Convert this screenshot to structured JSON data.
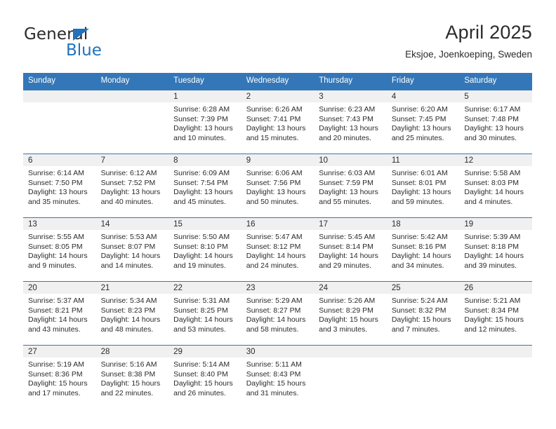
{
  "brand": {
    "name_top": "General",
    "name_bottom": "Blue",
    "triangle_color": "#1f72bd",
    "text_color": "#2b2b2b"
  },
  "header": {
    "title": "April 2025",
    "subtitle": "Eksjoe, Joenkoeping, Sweden"
  },
  "theme": {
    "header_blue": "#3477b8",
    "band_gray": "#f0f0f0",
    "text": "#2b2b2b",
    "cell_bg": "#ffffff"
  },
  "weekdays": [
    "Sunday",
    "Monday",
    "Tuesday",
    "Wednesday",
    "Thursday",
    "Friday",
    "Saturday"
  ],
  "labels": {
    "sunrise_prefix": "Sunrise:",
    "sunset_prefix": "Sunset:",
    "daylight_prefix": "Daylight:"
  },
  "weeks": [
    [
      {
        "empty": true
      },
      {
        "empty": true
      },
      {
        "day": "1",
        "sunrise": "Sunrise: 6:28 AM",
        "sunset": "Sunset: 7:39 PM",
        "daylight_1": "Daylight: 13 hours",
        "daylight_2": "and 10 minutes."
      },
      {
        "day": "2",
        "sunrise": "Sunrise: 6:26 AM",
        "sunset": "Sunset: 7:41 PM",
        "daylight_1": "Daylight: 13 hours",
        "daylight_2": "and 15 minutes."
      },
      {
        "day": "3",
        "sunrise": "Sunrise: 6:23 AM",
        "sunset": "Sunset: 7:43 PM",
        "daylight_1": "Daylight: 13 hours",
        "daylight_2": "and 20 minutes."
      },
      {
        "day": "4",
        "sunrise": "Sunrise: 6:20 AM",
        "sunset": "Sunset: 7:45 PM",
        "daylight_1": "Daylight: 13 hours",
        "daylight_2": "and 25 minutes."
      },
      {
        "day": "5",
        "sunrise": "Sunrise: 6:17 AM",
        "sunset": "Sunset: 7:48 PM",
        "daylight_1": "Daylight: 13 hours",
        "daylight_2": "and 30 minutes."
      }
    ],
    [
      {
        "day": "6",
        "sunrise": "Sunrise: 6:14 AM",
        "sunset": "Sunset: 7:50 PM",
        "daylight_1": "Daylight: 13 hours",
        "daylight_2": "and 35 minutes."
      },
      {
        "day": "7",
        "sunrise": "Sunrise: 6:12 AM",
        "sunset": "Sunset: 7:52 PM",
        "daylight_1": "Daylight: 13 hours",
        "daylight_2": "and 40 minutes."
      },
      {
        "day": "8",
        "sunrise": "Sunrise: 6:09 AM",
        "sunset": "Sunset: 7:54 PM",
        "daylight_1": "Daylight: 13 hours",
        "daylight_2": "and 45 minutes."
      },
      {
        "day": "9",
        "sunrise": "Sunrise: 6:06 AM",
        "sunset": "Sunset: 7:56 PM",
        "daylight_1": "Daylight: 13 hours",
        "daylight_2": "and 50 minutes."
      },
      {
        "day": "10",
        "sunrise": "Sunrise: 6:03 AM",
        "sunset": "Sunset: 7:59 PM",
        "daylight_1": "Daylight: 13 hours",
        "daylight_2": "and 55 minutes."
      },
      {
        "day": "11",
        "sunrise": "Sunrise: 6:01 AM",
        "sunset": "Sunset: 8:01 PM",
        "daylight_1": "Daylight: 13 hours",
        "daylight_2": "and 59 minutes."
      },
      {
        "day": "12",
        "sunrise": "Sunrise: 5:58 AM",
        "sunset": "Sunset: 8:03 PM",
        "daylight_1": "Daylight: 14 hours",
        "daylight_2": "and 4 minutes."
      }
    ],
    [
      {
        "day": "13",
        "sunrise": "Sunrise: 5:55 AM",
        "sunset": "Sunset: 8:05 PM",
        "daylight_1": "Daylight: 14 hours",
        "daylight_2": "and 9 minutes."
      },
      {
        "day": "14",
        "sunrise": "Sunrise: 5:53 AM",
        "sunset": "Sunset: 8:07 PM",
        "daylight_1": "Daylight: 14 hours",
        "daylight_2": "and 14 minutes."
      },
      {
        "day": "15",
        "sunrise": "Sunrise: 5:50 AM",
        "sunset": "Sunset: 8:10 PM",
        "daylight_1": "Daylight: 14 hours",
        "daylight_2": "and 19 minutes."
      },
      {
        "day": "16",
        "sunrise": "Sunrise: 5:47 AM",
        "sunset": "Sunset: 8:12 PM",
        "daylight_1": "Daylight: 14 hours",
        "daylight_2": "and 24 minutes."
      },
      {
        "day": "17",
        "sunrise": "Sunrise: 5:45 AM",
        "sunset": "Sunset: 8:14 PM",
        "daylight_1": "Daylight: 14 hours",
        "daylight_2": "and 29 minutes."
      },
      {
        "day": "18",
        "sunrise": "Sunrise: 5:42 AM",
        "sunset": "Sunset: 8:16 PM",
        "daylight_1": "Daylight: 14 hours",
        "daylight_2": "and 34 minutes."
      },
      {
        "day": "19",
        "sunrise": "Sunrise: 5:39 AM",
        "sunset": "Sunset: 8:18 PM",
        "daylight_1": "Daylight: 14 hours",
        "daylight_2": "and 39 minutes."
      }
    ],
    [
      {
        "day": "20",
        "sunrise": "Sunrise: 5:37 AM",
        "sunset": "Sunset: 8:21 PM",
        "daylight_1": "Daylight: 14 hours",
        "daylight_2": "and 43 minutes."
      },
      {
        "day": "21",
        "sunrise": "Sunrise: 5:34 AM",
        "sunset": "Sunset: 8:23 PM",
        "daylight_1": "Daylight: 14 hours",
        "daylight_2": "and 48 minutes."
      },
      {
        "day": "22",
        "sunrise": "Sunrise: 5:31 AM",
        "sunset": "Sunset: 8:25 PM",
        "daylight_1": "Daylight: 14 hours",
        "daylight_2": "and 53 minutes."
      },
      {
        "day": "23",
        "sunrise": "Sunrise: 5:29 AM",
        "sunset": "Sunset: 8:27 PM",
        "daylight_1": "Daylight: 14 hours",
        "daylight_2": "and 58 minutes."
      },
      {
        "day": "24",
        "sunrise": "Sunrise: 5:26 AM",
        "sunset": "Sunset: 8:29 PM",
        "daylight_1": "Daylight: 15 hours",
        "daylight_2": "and 3 minutes."
      },
      {
        "day": "25",
        "sunrise": "Sunrise: 5:24 AM",
        "sunset": "Sunset: 8:32 PM",
        "daylight_1": "Daylight: 15 hours",
        "daylight_2": "and 7 minutes."
      },
      {
        "day": "26",
        "sunrise": "Sunrise: 5:21 AM",
        "sunset": "Sunset: 8:34 PM",
        "daylight_1": "Daylight: 15 hours",
        "daylight_2": "and 12 minutes."
      }
    ],
    [
      {
        "day": "27",
        "sunrise": "Sunrise: 5:19 AM",
        "sunset": "Sunset: 8:36 PM",
        "daylight_1": "Daylight: 15 hours",
        "daylight_2": "and 17 minutes."
      },
      {
        "day": "28",
        "sunrise": "Sunrise: 5:16 AM",
        "sunset": "Sunset: 8:38 PM",
        "daylight_1": "Daylight: 15 hours",
        "daylight_2": "and 22 minutes."
      },
      {
        "day": "29",
        "sunrise": "Sunrise: 5:14 AM",
        "sunset": "Sunset: 8:40 PM",
        "daylight_1": "Daylight: 15 hours",
        "daylight_2": "and 26 minutes."
      },
      {
        "day": "30",
        "sunrise": "Sunrise: 5:11 AM",
        "sunset": "Sunset: 8:43 PM",
        "daylight_1": "Daylight: 15 hours",
        "daylight_2": "and 31 minutes."
      },
      {
        "empty": true
      },
      {
        "empty": true
      },
      {
        "empty": true
      }
    ]
  ]
}
